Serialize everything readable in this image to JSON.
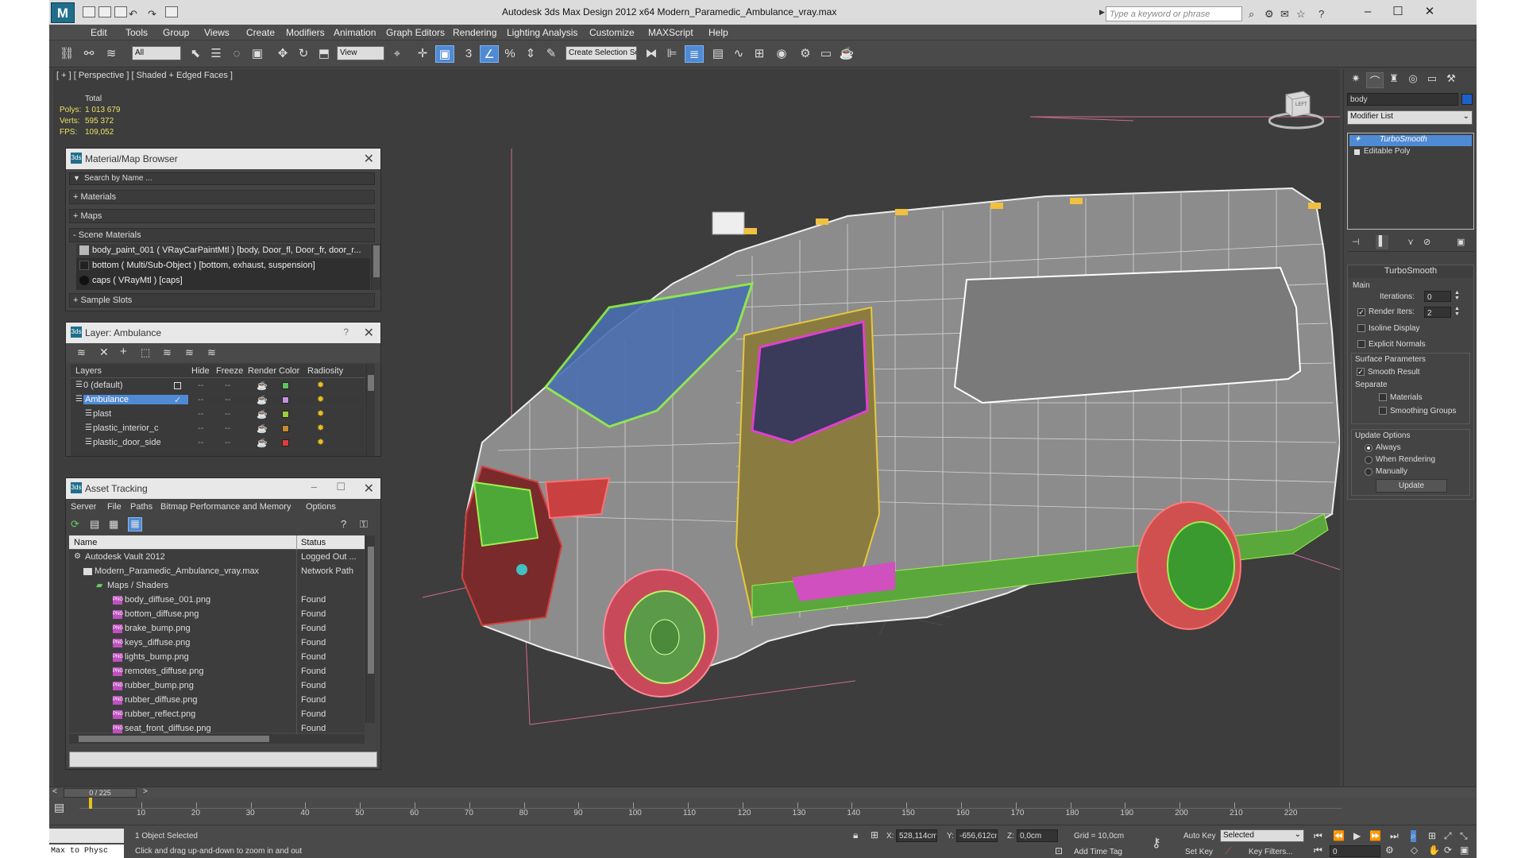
{
  "titlebar": {
    "app_title": "Autodesk 3ds Max Design 2012 x64      Modern_Paramedic_Ambulance_vray.max",
    "search_placeholder": "Type a keyword or phrase"
  },
  "menu": [
    "Edit",
    "Tools",
    "Group",
    "Views",
    "Create",
    "Modifiers",
    "Animation",
    "Graph Editors",
    "Rendering",
    "Lighting Analysis",
    "Customize",
    "MAXScript",
    "Help"
  ],
  "toolbar": {
    "selection_filter": "All",
    "ref_coord": "View",
    "named_selection": "Create Selection Se",
    "snap_label": "3"
  },
  "viewport": {
    "label": "[ + ] [ Perspective ] [ Shaded + Edged Faces ]",
    "stats_header": "Total",
    "polys_label": "Polys:",
    "polys_value": "1 013 679",
    "verts_label": "Verts:",
    "verts_value": "595 372",
    "fps_label": "FPS:",
    "fps_value": "109,052",
    "viewcube_label": "LEFT"
  },
  "material_browser": {
    "title": "Material/Map Browser",
    "search_placeholder": "Search by Name ...",
    "sections": [
      "+ Materials",
      "+ Maps",
      "- Scene Materials",
      "+ Sample Slots"
    ],
    "scene_materials": [
      "body_paint_001  ( VRayCarPaintMtl ) [body, Door_fl, Door_fr, door_r...",
      "bottom  ( Multi/Sub-Object ) [bottom, exhaust, suspension]",
      "caps  ( VRayMtl ) [caps]"
    ]
  },
  "layer_manager": {
    "title": "Layer: Ambulance",
    "help": "?",
    "columns": [
      "Layers",
      "Hide",
      "Freeze",
      "Render",
      "Color",
      "Radiosity"
    ],
    "rows": [
      {
        "name": "0 (default)",
        "color": "#5ec35e"
      },
      {
        "name": "Ambulance",
        "color": "#c78fe0"
      },
      {
        "name": "plast",
        "color": "#9ccc3c"
      },
      {
        "name": "plastic_interior_c",
        "color": "#c98b2e"
      },
      {
        "name": "plastic_door_side",
        "color": "#e03b3b"
      }
    ]
  },
  "asset_tracking": {
    "title": "Asset Tracking",
    "menu": [
      "Server",
      "File",
      "Paths",
      "Bitmap Performance and Memory",
      "Options"
    ],
    "columns": [
      "Name",
      "Status"
    ],
    "rows": [
      {
        "name": "Autodesk Vault 2012",
        "status": "Logged Out ..."
      },
      {
        "name": "Modern_Paramedic_Ambulance_vray.max",
        "status": "Network Path"
      },
      {
        "name": "Maps / Shaders",
        "status": ""
      },
      {
        "name": "body_diffuse_001.png",
        "status": "Found"
      },
      {
        "name": "bottom_diffuse.png",
        "status": "Found"
      },
      {
        "name": "brake_bump.png",
        "status": "Found"
      },
      {
        "name": "keys_diffuse.png",
        "status": "Found"
      },
      {
        "name": "lights_bump.png",
        "status": "Found"
      },
      {
        "name": "remotes_diffuse.png",
        "status": "Found"
      },
      {
        "name": "rubber_bump.png",
        "status": "Found"
      },
      {
        "name": "rubber_diffuse.png",
        "status": "Found"
      },
      {
        "name": "rubber_reflect.png",
        "status": "Found"
      },
      {
        "name": "seat_front_diffuse.png",
        "status": "Found"
      }
    ]
  },
  "command_panel": {
    "object_name": "body",
    "object_color": "#1f5fc8",
    "modifier_list": "Modifier List",
    "stack": [
      "TurboSmooth",
      "Editable Poly"
    ],
    "rollout_title": "TurboSmooth",
    "main_label": "Main",
    "iterations_label": "Iterations:",
    "iterations_value": "0",
    "render_iters_label": "Render Iters:",
    "render_iters_value": "2",
    "isoline_label": "Isoline Display",
    "explicit_normals_label": "Explicit Normals",
    "surface_params_label": "Surface Parameters",
    "smooth_result_label": "Smooth Result",
    "separate_label": "Separate",
    "materials_label": "Materials",
    "smoothing_groups_label": "Smoothing Groups",
    "update_options_label": "Update Options",
    "always_label": "Always",
    "when_rendering_label": "When Rendering",
    "manually_label": "Manually",
    "update_button": "Update"
  },
  "timeline": {
    "frame_readout": "0 / 225",
    "ticks": [
      "10",
      "20",
      "30",
      "40",
      "50",
      "60",
      "70",
      "80",
      "90",
      "100",
      "110",
      "120",
      "130",
      "140",
      "150",
      "160",
      "170",
      "180",
      "190",
      "200",
      "210",
      "220"
    ]
  },
  "status": {
    "maxscript": "Max to Physc",
    "selected": "1 Object Selected",
    "prompt": "Click and drag up-and-down to zoom in and out",
    "x_label": "X:",
    "x_value": "528,114cm",
    "y_label": "Y:",
    "y_value": "-656,612cm",
    "z_label": "Z:",
    "z_value": "0,0cm",
    "grid": "Grid = 10,0cm",
    "add_time_tag": "Add Time Tag",
    "auto_key": "Auto Key",
    "set_key": "Set Key",
    "selected_dropdown": "Selected",
    "key_filters": "Key Filters...",
    "frame_value": "0"
  }
}
